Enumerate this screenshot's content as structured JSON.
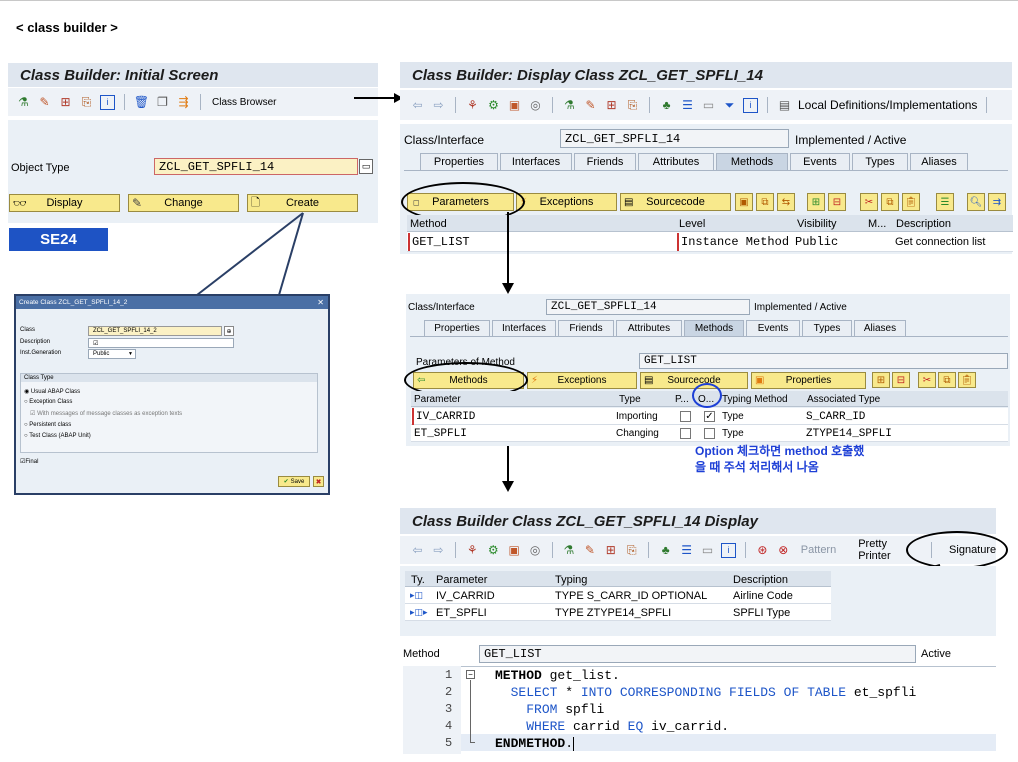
{
  "page": {
    "heading": "< class builder >"
  },
  "initial": {
    "title": "Class Builder: Initial Screen",
    "toolbar_label": "Class Browser",
    "object_type_label": "Object Type",
    "object_type_value": "ZCL_GET_SPFLI_14",
    "display_label": "Display",
    "change_label": "Change",
    "create_label": "Create",
    "tcode": "SE24"
  },
  "dialog": {
    "title": "Create Class ZCL_GET_SPFLI_14_2",
    "class_label": "Class",
    "class_value": "ZCL_GET_SPFLI_14_2",
    "description_label": "Description",
    "inst_label": "Inst.Generation",
    "inst_value": "Public",
    "class_type_label": "Class Type",
    "options": [
      "Usual ABAP Class",
      "Exception Class",
      "With messages of message classes as exception texts",
      "Persistent class",
      "Test Class (ABAP Unit)"
    ],
    "final_label": "Final",
    "save_label": "Save"
  },
  "display": {
    "title": "Class Builder: Display Class ZCL_GET_SPFLI_14",
    "local_defs": "Local Definitions/Implementations",
    "ci_label": "Class/Interface",
    "ci_value": "ZCL_GET_SPFLI_14",
    "status": "Implemented / Active",
    "tabs": [
      "Properties",
      "Interfaces",
      "Friends",
      "Attributes",
      "Methods",
      "Events",
      "Types",
      "Aliases"
    ],
    "buttons": {
      "parameters": "Parameters",
      "exceptions": "Exceptions",
      "sourcecode": "Sourcecode"
    },
    "columns": [
      "Method",
      "Level",
      "Visibility",
      "M...",
      "Description"
    ],
    "row": {
      "method": "GET_LIST",
      "level": "Instance Method",
      "visibility": "Public",
      "description": "Get connection list"
    }
  },
  "params": {
    "ci_label": "Class/Interface",
    "ci_value": "ZCL_GET_SPFLI_14",
    "status": "Implemented / Active",
    "tabs": [
      "Properties",
      "Interfaces",
      "Friends",
      "Attributes",
      "Methods",
      "Events",
      "Types",
      "Aliases"
    ],
    "pom_label": "Parameters of Method",
    "pom_value": "GET_LIST",
    "buttons": {
      "methods": "Methods",
      "exceptions": "Exceptions",
      "sourcecode": "Sourcecode",
      "properties": "Properties"
    },
    "columns": [
      "Parameter",
      "Type",
      "P...",
      "O...",
      "Typing Method",
      "Associated Type"
    ],
    "rows": [
      {
        "parameter": "IV_CARRID",
        "type": "Importing",
        "typing": "Type",
        "assoc": "S_CARR_ID"
      },
      {
        "parameter": "ET_SPFLI",
        "type": "Changing",
        "typing": "Type",
        "assoc": "ZTYPE14_SPFLI"
      }
    ],
    "note_line1": "Option 체크하면 method 호출했",
    "note_line2": "을 때 주석 처리해서 나옴"
  },
  "source": {
    "title": "Class Builder Class ZCL_GET_SPFLI_14 Display",
    "pattern": "Pattern",
    "pretty_printer": "Pretty Printer",
    "signature": "Signature",
    "columns": [
      "Ty.",
      "Parameter",
      "Typing",
      "Description"
    ],
    "rows": [
      {
        "parameter": "IV_CARRID",
        "typing": "TYPE S_CARR_ID OPTIONAL",
        "description": "Airline Code"
      },
      {
        "parameter": "ET_SPFLI",
        "typing": "TYPE ZTYPE14_SPFLI",
        "description": "SPFLI Type"
      }
    ],
    "method_label": "Method",
    "method_value": "GET_LIST",
    "active": "Active",
    "line_numbers": [
      "1",
      "2",
      "3",
      "4",
      "5"
    ]
  },
  "colors": {
    "title_bg": "#dfe6ef",
    "button_yellow": "#f8e98c",
    "tcode_blue": "#1e53c4",
    "keyword_blue": "#1d55c8",
    "note_blue": "#1d3fd6"
  }
}
